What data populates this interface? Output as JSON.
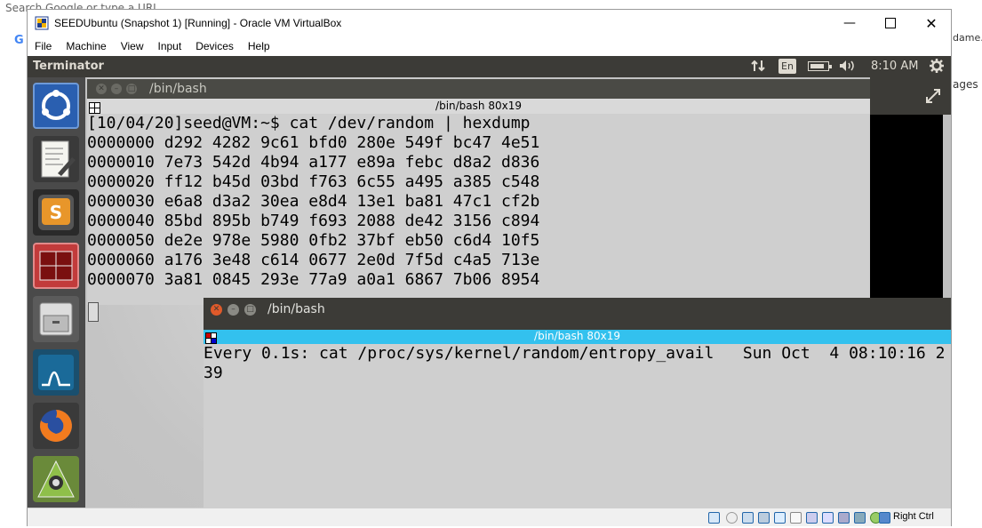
{
  "background": {
    "search_text": "Search Google or type a URL",
    "google_letter": "G",
    "right_text_1": "dame..",
    "right_text_2": "ages"
  },
  "vbox": {
    "title": "SEEDUbuntu (Snapshot 1) [Running] - Oracle VM VirtualBox",
    "menu": [
      "File",
      "Machine",
      "View",
      "Input",
      "Devices",
      "Help"
    ],
    "host_key": "Right Ctrl"
  },
  "panel": {
    "app_title": "Terminator",
    "keyboard_layout": "En",
    "time": "8:10 AM"
  },
  "terminal1": {
    "window_title": "/bin/bash",
    "subtitle": "/bin/bash 80x19",
    "lines": [
      "[10/04/20]seed@VM:~$ cat /dev/random | hexdump",
      "0000000 d292 4282 9c61 bfd0 280e 549f bc47 4e51",
      "0000010 7e73 542d 4b94 a177 e89a febc d8a2 d836",
      "0000020 ff12 b45d 03bd f763 6c55 a495 a385 c548",
      "0000030 e6a8 d3a2 30ea e8d4 13e1 ba81 47c1 cf2b",
      "0000040 85bd 895b b749 f693 2088 de42 3156 c894",
      "0000050 de2e 978e 5980 0fb2 37bf eb50 c6d4 10f5",
      "0000060 a176 3e48 c614 0677 2e0d 7f5d c4a5 713e",
      "0000070 3a81 0845 293e 77a9 a0a1 6867 7b06 8954"
    ]
  },
  "terminal2": {
    "window_title": "/bin/bash",
    "subtitle": "/bin/bash 80x19",
    "lines": [
      "Every 0.1s: cat /proc/sys/kernel/random/entropy_avail   Sun Oct  4 08:10:16 2",
      "",
      "39"
    ]
  },
  "colors": {
    "panel_bg": "#3c3b37",
    "launcher_bg": "#4a4a4a",
    "terminal_focus_bar": "#33c1ee",
    "close_button": "#e05a2a"
  }
}
